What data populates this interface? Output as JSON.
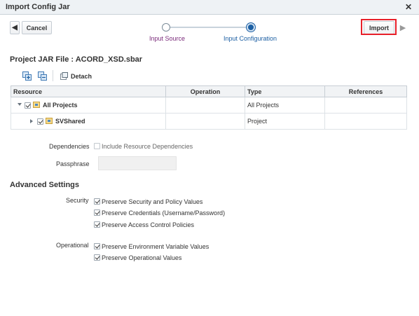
{
  "dialog": {
    "title": "Import Config Jar"
  },
  "toolbar": {
    "cancel_label": "Cancel",
    "import_label": "Import"
  },
  "train": {
    "steps": [
      "Input Source",
      "Input Configuration"
    ]
  },
  "project": {
    "heading": "Project JAR File : ACORD_XSD.sbar",
    "detach_label": "Detach"
  },
  "table": {
    "headers": [
      "Resource",
      "Operation",
      "Type",
      "References"
    ],
    "rows": [
      {
        "resource": "All Projects",
        "operation": "",
        "type": "All Projects",
        "references": ""
      },
      {
        "resource": "SVShared",
        "operation": "",
        "type": "Project",
        "references": ""
      }
    ]
  },
  "dependencies": {
    "label": "Dependencies",
    "checkbox_label": "Include Resource Dependencies",
    "checked": false
  },
  "passphrase": {
    "label": "Passphrase",
    "value": ""
  },
  "advanced": {
    "heading": "Advanced Settings",
    "security_label": "Security",
    "security_options": [
      "Preserve Security and Policy Values",
      "Preserve Credentials (Username/Password)",
      "Preserve Access Control Policies"
    ],
    "operational_label": "Operational",
    "operational_options": [
      "Preserve Environment Variable Values",
      "Preserve Operational Values"
    ]
  },
  "colors": {
    "accent": "#1c5fa3",
    "step1": "#7a2a7a",
    "highlight": "#e8202a"
  }
}
